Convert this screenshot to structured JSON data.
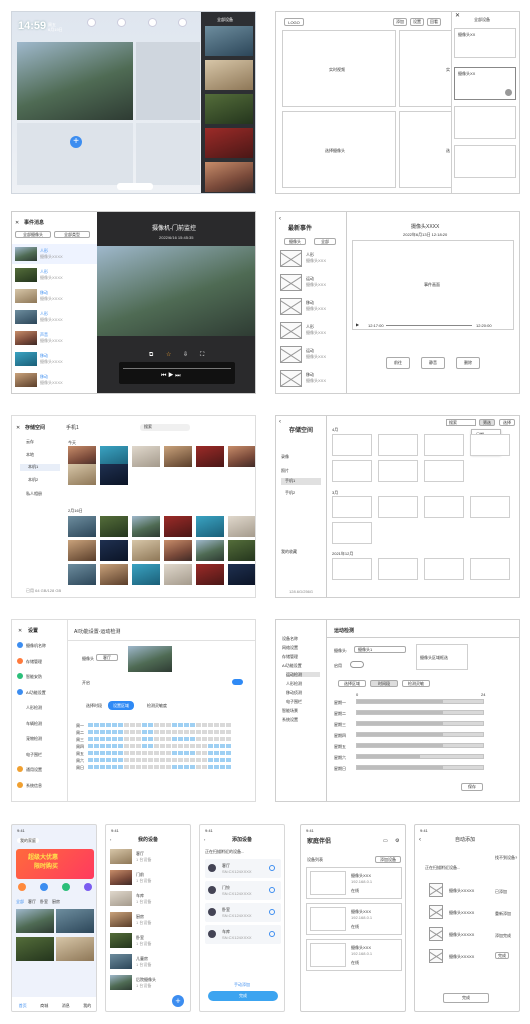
{
  "p1": {
    "time": "14:59",
    "date_line1": "周五",
    "date_line2": "6月19日",
    "top_icons": [
      "",
      "",
      "",
      ""
    ],
    "sidebar_title": "全部设备",
    "plus": "+"
  },
  "p2": {
    "logo": "LOGO",
    "btns": [
      "添加",
      "设置",
      "回看"
    ],
    "cell_labels": [
      "实时视频",
      "实",
      "选择摄像头",
      "选"
    ],
    "side_title": "全部设备",
    "side_items": [
      "摄像头XX",
      "摄像头XX",
      "",
      ""
    ]
  },
  "p3": {
    "title": "事件消息",
    "filter1": "全部摄像头",
    "filter2": "全部类型",
    "events": [
      {
        "name": "人形",
        "info": "摄像头XXXX"
      },
      {
        "name": "人形",
        "info": "摄像头XXXX"
      },
      {
        "name": "移动",
        "info": "摄像头XXXX"
      },
      {
        "name": "人形",
        "info": "摄像头XXXX"
      },
      {
        "name": "声音",
        "info": "摄像头XXXX"
      },
      {
        "name": "移动",
        "info": "摄像头XXXX"
      },
      {
        "name": "移动",
        "info": "摄像头XXXX"
      }
    ],
    "player_title": "摄像机-门前监控",
    "player_time": "2022/6/16 15:45:35",
    "ctrl_icons": [
      "⧉",
      "☆",
      "⇩",
      "⛶"
    ]
  },
  "p4": {
    "title": "最新事件",
    "sel1": "摄像头",
    "sel2": "全部",
    "events": [
      {
        "name": "人形",
        "sub": "摄像头XXX"
      },
      {
        "name": "运动",
        "sub": "摄像头XXX"
      },
      {
        "name": "移动",
        "sub": "摄像头XXX"
      },
      {
        "name": "人形",
        "sub": "摄像头XXX"
      },
      {
        "name": "运动",
        "sub": "摄像头XXX"
      },
      {
        "name": "移动",
        "sub": "摄像头XXX"
      }
    ],
    "video_title": "摄像头XXXX",
    "video_date": "2022年6月13日 12:18:20",
    "video_label": "事件画面",
    "t_start": "12:17:00",
    "t_end": "12:20:00",
    "actions": [
      "前往",
      "静音",
      "删除"
    ]
  },
  "p5": {
    "title": "存储空间",
    "nav": [
      "云存",
      "本地",
      "本机1",
      "本机2",
      "私人相册"
    ],
    "device": "手机1",
    "search": "搜索",
    "section1": "今天",
    "section2": "2月16日",
    "footer": "已用 64 GB/128 GB"
  },
  "p6": {
    "title": "存储空间",
    "nav": [
      "录像",
      "照片",
      "手机1",
      "手机2",
      "我的收藏"
    ],
    "search": "搜索",
    "btn1": "筛选",
    "btn2": "选择",
    "dropdown": [
      "日期",
      "类型",
      "设备"
    ],
    "months": [
      "4月",
      "3月",
      "2021年12月"
    ],
    "footer": "128.6G/256G"
  },
  "p7": {
    "title": "设置",
    "nav": [
      "摄像机名称",
      "存储管理",
      "智能安防",
      "AI功能设置",
      "人形检测",
      "车辆检测",
      "宠物检测",
      "电子围栏",
      "通用设置",
      "系统信息"
    ],
    "header": "AI功能设置-运动检测",
    "field1": "摄像头",
    "field1_val": "客厅",
    "toggle_label": "开启",
    "tabs": [
      "选择时段",
      "设置区域",
      "检测灵敏度"
    ],
    "days": [
      "周一",
      "周二",
      "周三",
      "周四",
      "周五",
      "周六",
      "周日"
    ]
  },
  "p8": {
    "nav": [
      "设备名称",
      "网络设置",
      "存储管理",
      "AI功能设置",
      "运动检测",
      "人形检测",
      "移动侦测",
      "电子围栏",
      "智能场景",
      "系统设置"
    ],
    "header": "运动检测",
    "field1": "摄像头:",
    "field1_val": "摄像头1",
    "field2": "启用",
    "preview": "摄像头区域框选",
    "tabs": [
      "选择区域",
      "时间段",
      "检测灵敏"
    ],
    "scale_min": "0",
    "scale_max": "24",
    "rows": [
      "星期一",
      "星期二",
      "星期三",
      "星期四",
      "星期五",
      "星期六",
      "星期日"
    ],
    "save": "保存"
  },
  "phones": {
    "a": {
      "status": "9:41",
      "title": "我的家庭",
      "banner1": "超级大优惠",
      "banner2": "限时购买",
      "cats": [
        "全部",
        "客厅",
        "卧室",
        "厨房"
      ],
      "tabs": [
        "首页",
        "商城",
        "消息",
        "我的"
      ]
    },
    "b": {
      "status": "9:41",
      "title": "我的设备",
      "items": [
        "客厅",
        "门前",
        "车库",
        "厨房",
        "卧室",
        "儿童房",
        "后院摄像头"
      ],
      "sub": "1 台设备"
    },
    "c": {
      "status": "9:41",
      "title": "添加设备",
      "hint": "正在扫描附近的设备...",
      "items": [
        "客厅",
        "门铃",
        "卧室",
        "车库"
      ],
      "ids": [
        "SN:CX124XXXX",
        "SN:CX124XXXX",
        "SN:CX124XXXX",
        "SN:CX124XXXX"
      ],
      "btn": "完成",
      "link": "手动添加"
    },
    "d": {
      "status": "9:41",
      "title": "家庭伴侣",
      "list_title": "设备列表",
      "add": "添加设备",
      "items": [
        {
          "name": "摄像头XXX",
          "ip": "192.168.0.1",
          "tag": "在线"
        },
        {
          "name": "摄像头XXX",
          "ip": "192.168.0.1",
          "tag": "在线"
        },
        {
          "name": "摄像头XXX",
          "ip": "192.168.0.1",
          "tag": "在线"
        }
      ]
    },
    "e": {
      "status": "9:41",
      "title": "自动添加",
      "hint": "正在扫描附近设备...",
      "link": "找不到设备?",
      "items": [
        "摄像头XXXXX",
        "摄像头XXXXX",
        "摄像头XXXXX",
        "摄像头XXXXX"
      ],
      "actions": [
        "已添加",
        "重新添加",
        "添加完成",
        "完成"
      ],
      "btn": "完成"
    }
  }
}
